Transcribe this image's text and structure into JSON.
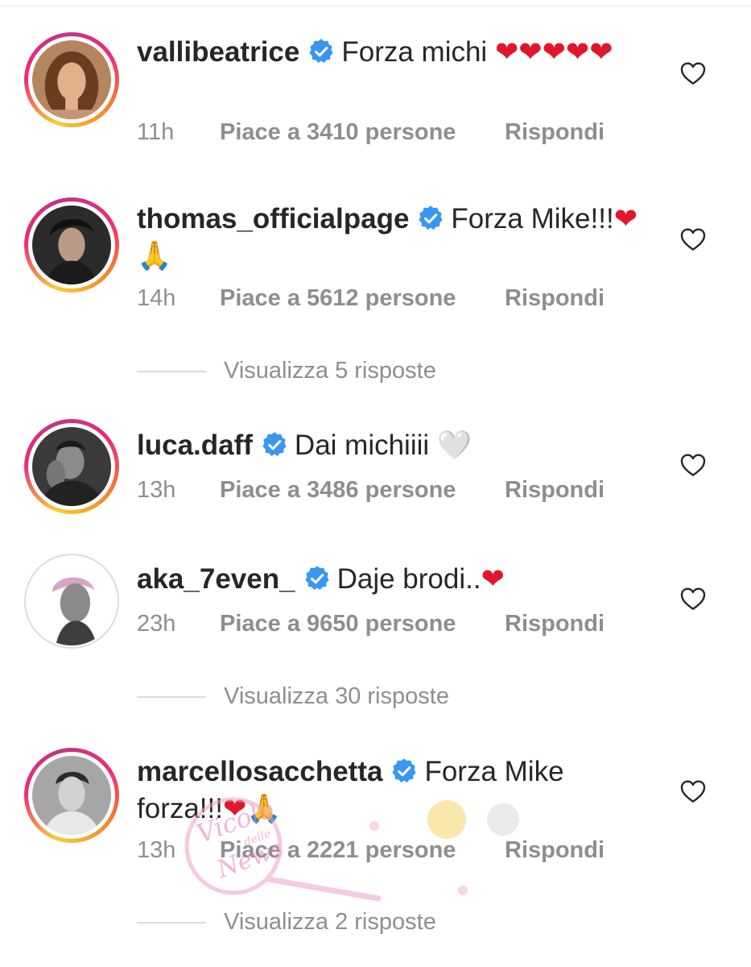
{
  "comments": [
    {
      "username": "vallibeatrice",
      "text": "Forza michi ",
      "emojis": "❤❤❤❤❤",
      "time": "11h",
      "likes": "Piace a 3410 persone",
      "reply": "Rispondi"
    },
    {
      "username": "thomas_officialpage",
      "text": "Forza Mike!!!",
      "emojis": "❤",
      "emojis2": "🙏",
      "time": "14h",
      "likes": "Piace a 5612 persone",
      "reply": "Rispondi",
      "view_replies": "Visualizza 5 risposte"
    },
    {
      "username": "luca.daff",
      "text": "Dai michiiii ",
      "emojis": "🤍",
      "time": "13h",
      "likes": "Piace a 3486 persone",
      "reply": "Rispondi"
    },
    {
      "username": "aka_7even_",
      "text": "Daje brodi..",
      "emojis": "❤",
      "time": "23h",
      "likes": "Piace a 9650 persone",
      "reply": "Rispondi",
      "view_replies": "Visualizza 30 risposte"
    },
    {
      "username": "marcellosacchetta",
      "text": "Forza Mike forza!!!",
      "emojis": "❤🙏",
      "time": "13h",
      "likes": "Piace a 2221 persone",
      "reply": "Rispondi",
      "view_replies": "Visualizza 2 risposte"
    }
  ],
  "icons": {
    "verified": "verified-badge-icon",
    "like": "heart-outline-icon"
  },
  "colors": {
    "verified_blue": "#3897f0",
    "meta_gray": "#8e8e8e",
    "heart_red": "#e0162b"
  },
  "watermark": {
    "text_1": "Vicolo",
    "text_2": "delle",
    "text_3": "News"
  }
}
